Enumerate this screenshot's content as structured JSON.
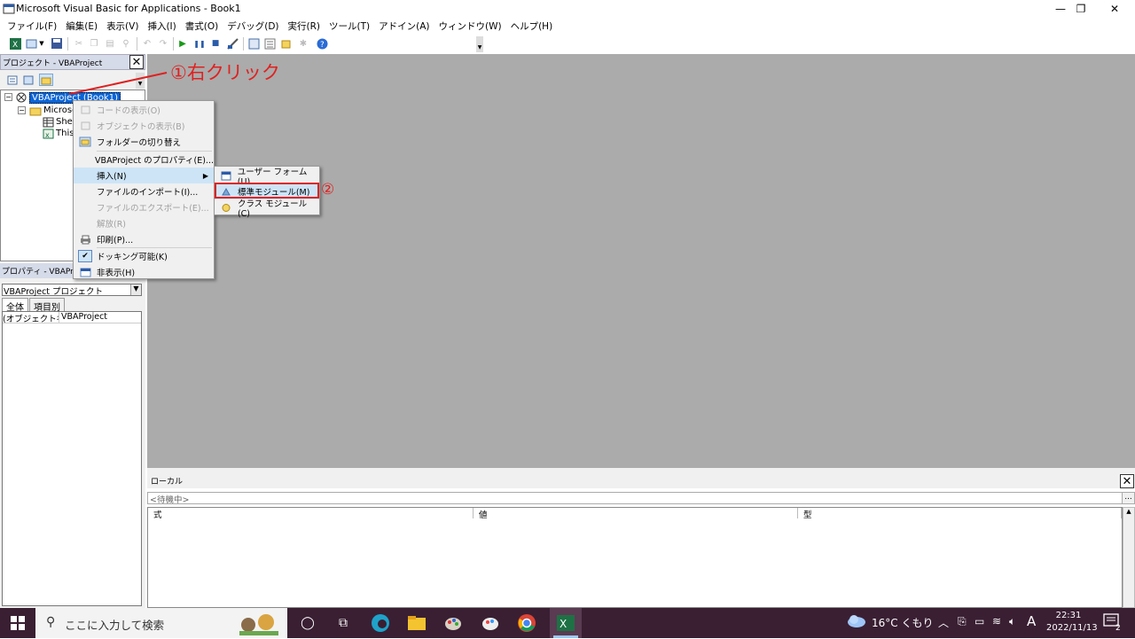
{
  "window": {
    "title": "Microsoft Visual Basic for Applications - Book1",
    "controls": {
      "minimize": "—",
      "restore": "❐",
      "close": "✕"
    }
  },
  "menubar": {
    "items": [
      "ファイル(F)",
      "編集(E)",
      "表示(V)",
      "挿入(I)",
      "書式(O)",
      "デバッグ(D)",
      "実行(R)",
      "ツール(T)",
      "アドイン(A)",
      "ウィンドウ(W)",
      "ヘルプ(H)"
    ]
  },
  "project_pane": {
    "title": "プロジェクト - VBAProject",
    "close": "✕",
    "tree": {
      "root": "VBAProject (Book1)",
      "folder": "Microso",
      "sheet": "Shee",
      "workbook": "This"
    }
  },
  "properties_pane": {
    "title": "プロパティ - VBAProject",
    "combo_value": "VBAProject プロジェクト",
    "tabs": [
      "全体",
      "項目別"
    ],
    "row_name": "(オブジェクト名)",
    "row_value": "VBAProject"
  },
  "locals": {
    "title": "ローカル",
    "close": "✕",
    "context": "<待機中>",
    "context_button": "...",
    "columns": [
      "式",
      "値",
      "型"
    ]
  },
  "context_menu": {
    "items": [
      {
        "label": "コードの表示(O)",
        "disabled": true,
        "icon": "code-icon"
      },
      {
        "label": "オブジェクトの表示(B)",
        "disabled": true,
        "icon": "object-icon"
      },
      {
        "label": "フォルダーの切り替え",
        "disabled": false,
        "icon": "folder-icon"
      },
      {
        "label": "VBAProject のプロパティ(E)...",
        "disabled": false,
        "icon": ""
      },
      {
        "label": "挿入(N)",
        "disabled": false,
        "icon": "",
        "highlighted": true,
        "submenu": true
      },
      {
        "label": "ファイルのインポート(I)...",
        "disabled": false,
        "icon": ""
      },
      {
        "label": "ファイルのエクスポート(E)...",
        "disabled": true,
        "icon": ""
      },
      {
        "label": "解放(R)",
        "disabled": true,
        "icon": ""
      },
      {
        "label": "印刷(P)...",
        "disabled": false,
        "icon": "printer-icon"
      },
      {
        "label": "ドッキング可能(K)",
        "disabled": false,
        "icon": "checkmark-icon"
      },
      {
        "label": "非表示(H)",
        "disabled": false,
        "icon": "hide-icon"
      }
    ]
  },
  "submenu": {
    "items": [
      {
        "label": "ユーザー フォーム(U)",
        "icon": "userform-icon"
      },
      {
        "label": "標準モジュール(M)",
        "icon": "module-icon",
        "highlighted": true
      },
      {
        "label": "クラス モジュール(C)",
        "icon": "class-module-icon"
      }
    ]
  },
  "annotations": {
    "step1": "①右クリック",
    "step2": "②"
  },
  "taskbar": {
    "search_placeholder": "ここに入力して検索",
    "weather": "16°C くもり",
    "ime": "A",
    "time": "22:31",
    "date": "2022/11/13",
    "notifications": "2"
  },
  "colors": {
    "annotation": "#e02020",
    "mdi_background": "#ababab",
    "taskbar": "#3a1f33",
    "menu_highlight": "#cde4f7"
  }
}
